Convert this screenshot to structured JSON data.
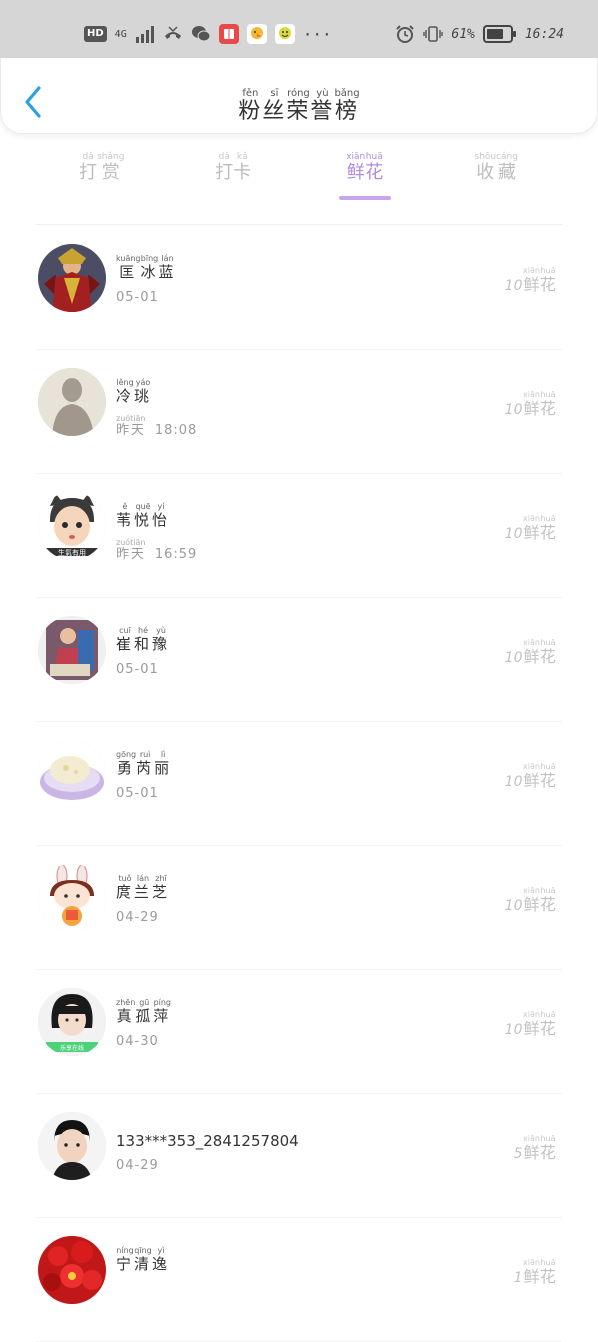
{
  "status_bar": {
    "hd": "HD",
    "network": "4G",
    "battery": "61%",
    "time": "16:24",
    "more": "···"
  },
  "header": {
    "title": [
      {
        "char": "粉",
        "pinyin": "fěn"
      },
      {
        "char": "丝",
        "pinyin": "sī"
      },
      {
        "char": "荣",
        "pinyin": "róng"
      },
      {
        "char": "誉",
        "pinyin": "yù"
      },
      {
        "char": "榜",
        "pinyin": "bǎng"
      }
    ]
  },
  "tabs": [
    {
      "chars": [
        {
          "char": "打",
          "pinyin": "dǎ"
        },
        {
          "char": "赏",
          "pinyin": "shǎng"
        }
      ],
      "active": false
    },
    {
      "chars": [
        {
          "char": "打",
          "pinyin": "dǎ"
        },
        {
          "char": "卡",
          "pinyin": "kǎ"
        }
      ],
      "active": false
    },
    {
      "chars": [
        {
          "char": "鲜",
          "pinyin": "xiān"
        },
        {
          "char": "花",
          "pinyin": "huā"
        }
      ],
      "active": true
    },
    {
      "chars": [
        {
          "char": "收",
          "pinyin": "shōu"
        },
        {
          "char": "藏",
          "pinyin": "cáng"
        }
      ],
      "active": false
    }
  ],
  "unit": [
    {
      "char": "鲜",
      "pinyin": "xiān"
    },
    {
      "char": "花",
      "pinyin": "huā"
    }
  ],
  "fans": [
    {
      "name": [
        {
          "char": "匡",
          "pinyin": "kuāng"
        },
        {
          "char": "冰",
          "pinyin": "bīng"
        },
        {
          "char": "蓝",
          "pinyin": "lán"
        }
      ],
      "time_text": "05-01",
      "count": "10",
      "avatar": "warrior-avatar"
    },
    {
      "name": [
        {
          "char": "冷",
          "pinyin": "lěng"
        },
        {
          "char": "珧",
          "pinyin": "yáo"
        }
      ],
      "time_chars": [
        {
          "char": "昨",
          "pinyin": "zuó"
        },
        {
          "char": "天",
          "pinyin": "tiān"
        }
      ],
      "time_text": "18:08",
      "count": "10",
      "avatar": "shadow-avatar"
    },
    {
      "name": [
        {
          "char": "苇",
          "pinyin": "ě"
        },
        {
          "char": "悦",
          "pinyin": "quē"
        },
        {
          "char": "怡",
          "pinyin": "yí"
        }
      ],
      "time_chars": [
        {
          "char": "昨",
          "pinyin": "zuó"
        },
        {
          "char": "天",
          "pinyin": "tiān"
        }
      ],
      "time_text": "16:59",
      "count": "10",
      "avatar": "cat-girl-avatar"
    },
    {
      "name": [
        {
          "char": "崔",
          "pinyin": "cuī"
        },
        {
          "char": "和",
          "pinyin": "hé"
        },
        {
          "char": "豫",
          "pinyin": "yù"
        }
      ],
      "time_text": "05-01",
      "count": "10",
      "avatar": "photo-avatar"
    },
    {
      "name": [
        {
          "char": "勇",
          "pinyin": "gōng"
        },
        {
          "char": "芮",
          "pinyin": "ruì"
        },
        {
          "char": "丽",
          "pinyin": "lì"
        }
      ],
      "time_text": "05-01",
      "count": "10",
      "avatar": "food-avatar"
    },
    {
      "name": [
        {
          "char": "庹",
          "pinyin": "tuǒ"
        },
        {
          "char": "兰",
          "pinyin": "lán"
        },
        {
          "char": "芝",
          "pinyin": "zhī"
        }
      ],
      "time_text": "04-29",
      "count": "10",
      "avatar": "bunny-avatar"
    },
    {
      "name": [
        {
          "char": "真",
          "pinyin": "zhēn"
        },
        {
          "char": "孤",
          "pinyin": "gū"
        },
        {
          "char": "萍",
          "pinyin": "píng"
        }
      ],
      "time_text": "04-30",
      "count": "10",
      "avatar": "girl-avatar"
    },
    {
      "name_text": "133***353_2841257804",
      "time_text": "04-29",
      "count": "5",
      "avatar": "boy-avatar"
    },
    {
      "name": [
        {
          "char": "宁",
          "pinyin": "níng"
        },
        {
          "char": "清",
          "pinyin": "qīng"
        },
        {
          "char": "逸",
          "pinyin": "yì"
        }
      ],
      "time_text": "",
      "count": "1",
      "avatar": "flower-avatar"
    }
  ]
}
